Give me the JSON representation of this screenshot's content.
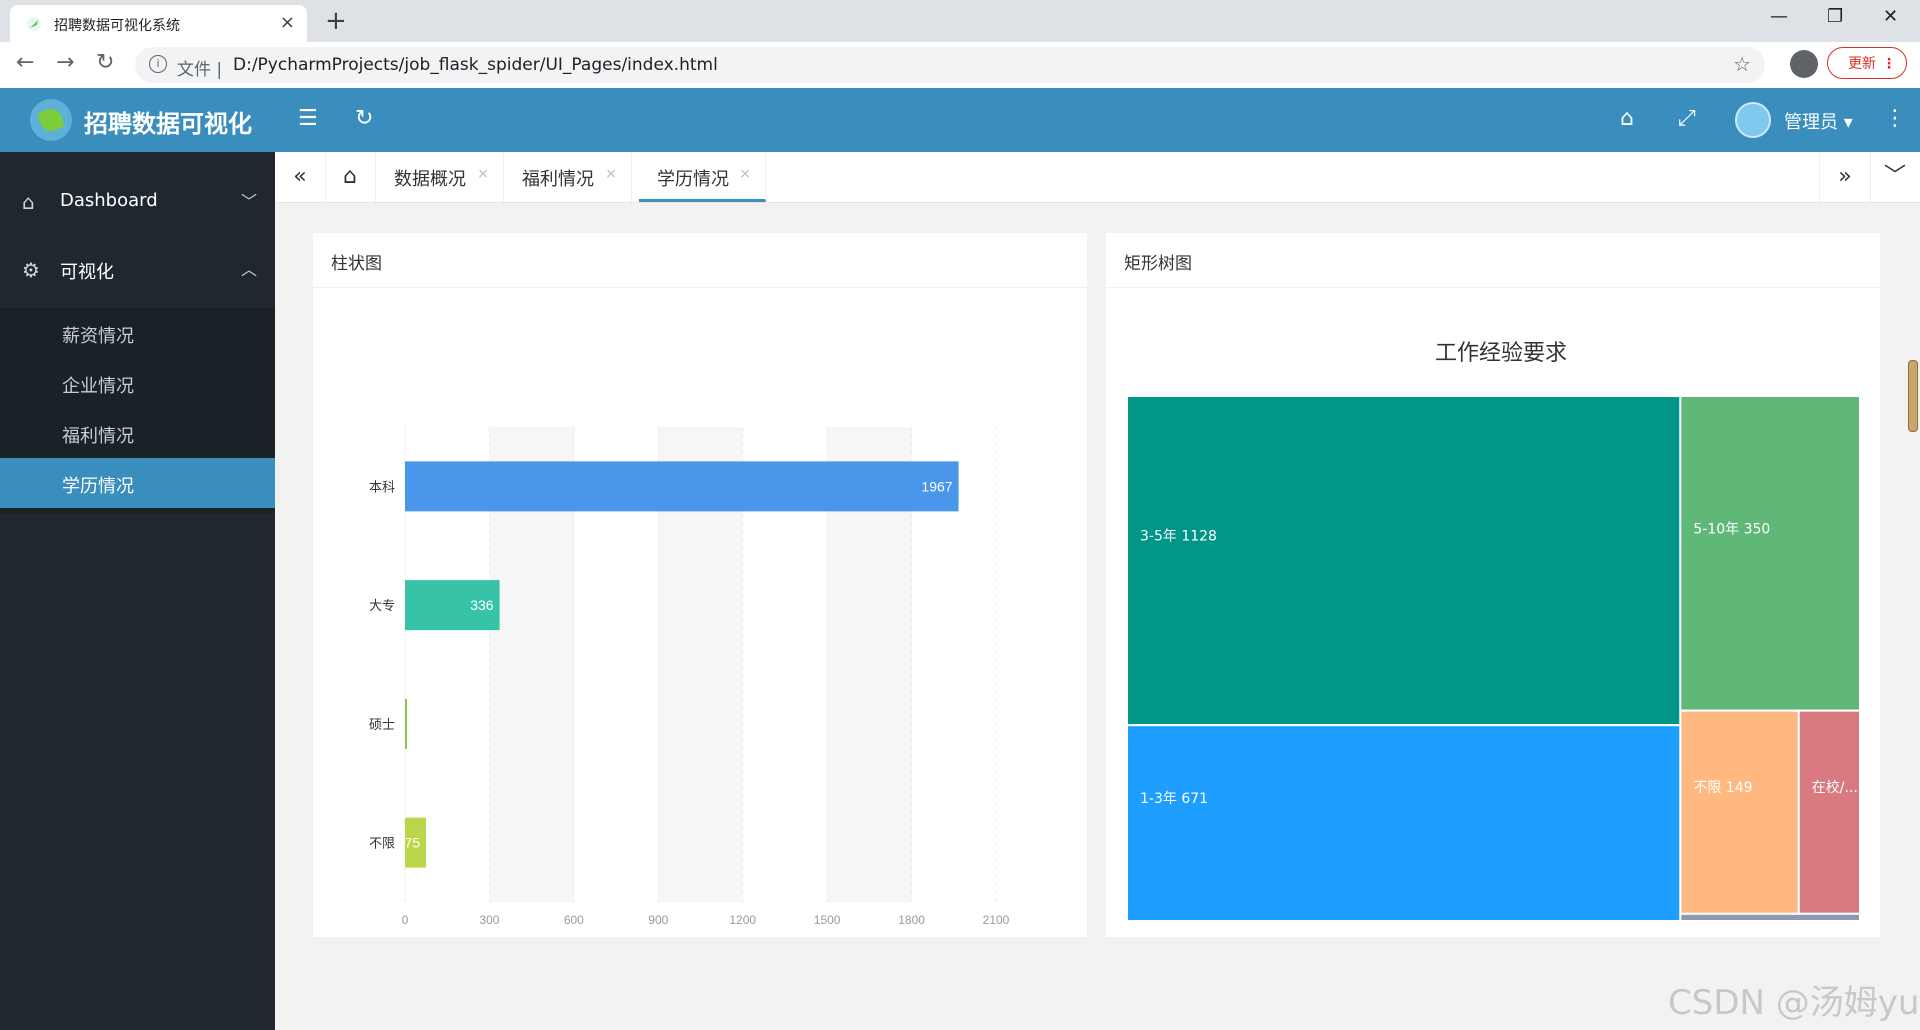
{
  "browser": {
    "tab_title": "招聘数据可视化系统",
    "tab_close": "×",
    "new_tab": "+",
    "window_controls": {
      "minimize": "—",
      "restore": "❐",
      "close": "✕"
    },
    "url_prefix": "文件 |",
    "url": "D:/PycharmProjects/job_flask_spider/UI_Pages/index.html",
    "update_label": "更新",
    "update_menu": "⋮"
  },
  "header": {
    "brand": "招聘数据可视化",
    "admin": "管理员 ▾"
  },
  "sidebar": {
    "items": [
      {
        "label": "Dashboard",
        "icon": "home-icon",
        "chevron": "⌄"
      },
      {
        "label": "可视化",
        "icon": "gear-icon",
        "chevron": "⌃"
      }
    ],
    "subitems": [
      {
        "label": "薪资情况"
      },
      {
        "label": "企业情况"
      },
      {
        "label": "福利情况"
      },
      {
        "label": "学历情况",
        "active": true
      }
    ]
  },
  "page_tabs": {
    "tabs": [
      {
        "label": "数据概况",
        "close": "×"
      },
      {
        "label": "福利情况",
        "close": "×"
      },
      {
        "label": "学历情况",
        "close": "×",
        "active": true
      }
    ]
  },
  "cards": {
    "bar": {
      "title": "柱状图"
    },
    "treemap": {
      "title": "矩形树图"
    }
  },
  "chart_data": [
    {
      "type": "bar",
      "orientation": "horizontal",
      "categories": [
        "本科",
        "大专",
        "硕士",
        "不限"
      ],
      "values": [
        1967,
        336,
        2,
        75
      ],
      "colors": [
        "#4a96ea",
        "#37c3a8",
        "#8bc34a",
        "#bcd64b"
      ],
      "xticks": [
        "0",
        "300",
        "600",
        "900",
        "1200",
        "1500",
        "1800",
        "2100"
      ],
      "xlim": [
        0,
        2100
      ],
      "grid": "alternating vertical bands"
    },
    {
      "type": "treemap",
      "title": "工作经验要求",
      "items": [
        {
          "name": "3-5年",
          "value": 1128,
          "label": "3-5年 1128",
          "color": "#009688"
        },
        {
          "name": "1-3年",
          "value": 671,
          "label": "1-3年 671",
          "color": "#1e9fff"
        },
        {
          "name": "5-10年",
          "value": 350,
          "label": "5-10年 350",
          "color": "#5fb878"
        },
        {
          "name": "不限",
          "value": 149,
          "label": "不限 149",
          "color": "#ffb980"
        },
        {
          "name": "在校/...",
          "value": 77,
          "label": "在校/...",
          "color": "#d87a80"
        },
        {
          "name": "",
          "value": 8,
          "label": "",
          "color": "#8d98b3"
        }
      ]
    }
  ],
  "watermark": "CSDN @汤姆yu"
}
